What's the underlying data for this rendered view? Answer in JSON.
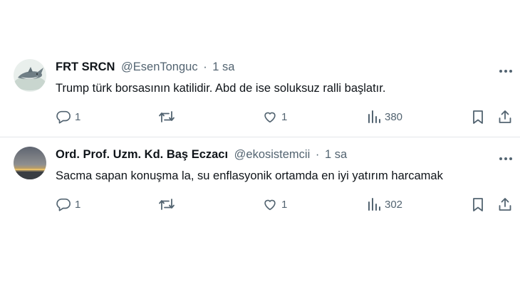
{
  "tweets": [
    {
      "display_name": "FRT SRCN",
      "handle": "@EsenTonguc",
      "separator": "·",
      "time": "1 sa",
      "text": "Trump türk borsasının katilidir.  Abd de ise soluksuz ralli başlatır.",
      "replies": "1",
      "likes": "1",
      "views": "380",
      "avatar": "shark-avatar"
    },
    {
      "display_name": "Ord. Prof. Uzm. Kd. Baş Eczacı",
      "handle": "@ekosistemcii",
      "separator": "·",
      "time": "1 sa",
      "text": "Sacma sapan konuşma la, su enflasyonik ortamda en iyi yatırım harcamak",
      "replies": "1",
      "likes": "1",
      "views": "302",
      "avatar": "sunset-avatar"
    }
  ],
  "colors": {
    "text_primary": "#0f1419",
    "text_secondary": "#536471",
    "divider": "#e3e7ea"
  },
  "icons": [
    "reply-icon",
    "retweet-icon",
    "like-icon",
    "views-icon",
    "bookmark-icon",
    "share-icon",
    "more-icon"
  ]
}
